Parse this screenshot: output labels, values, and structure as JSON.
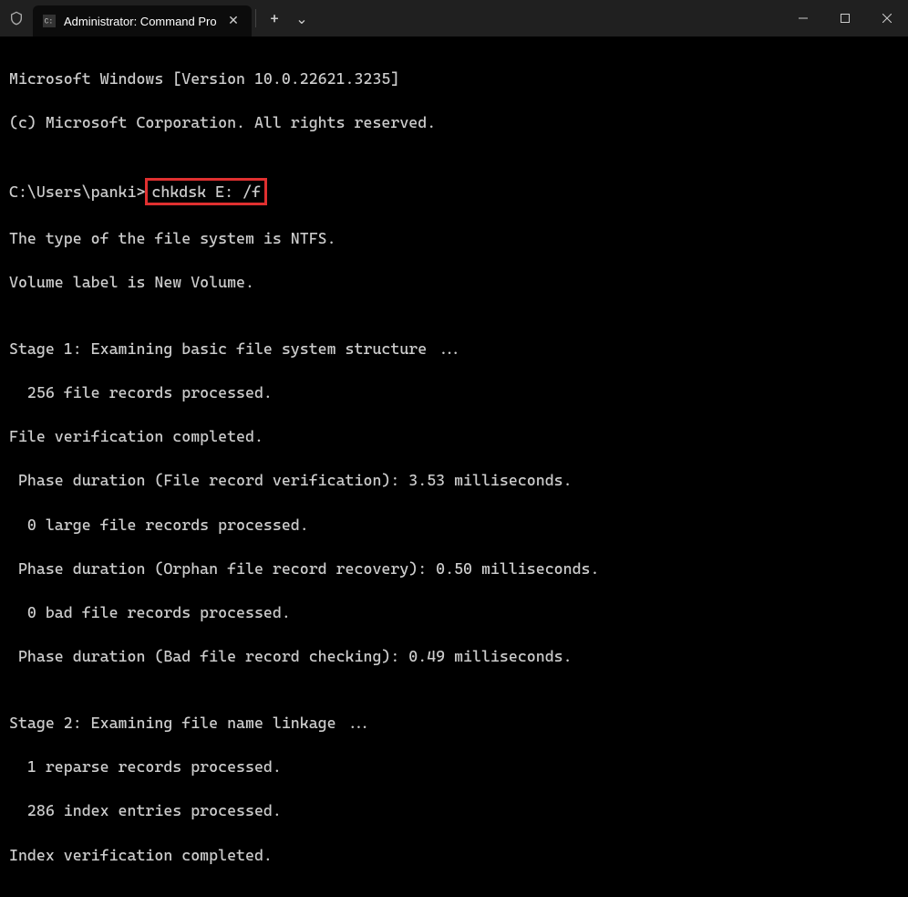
{
  "titlebar": {
    "tab_title": "Administrator: Command Pro",
    "new_tab_symbol": "+",
    "dropdown_symbol": "⌄",
    "close_symbol": "✕",
    "minimize_symbol": "—",
    "maximize_symbol": "▢"
  },
  "terminal": {
    "line1": "Microsoft Windows [Version 10.0.22621.3235]",
    "line2": "(c) Microsoft Corporation. All rights reserved.",
    "blank1": "",
    "prompt": "C:\\Users\\panki>",
    "command": "chkdsk E: /f",
    "line3": "The type of the file system is NTFS.",
    "line4": "Volume label is New Volume.",
    "blank2": "",
    "line5": "Stage 1: Examining basic file system structure ...",
    "line6": "  256 file records processed.",
    "line7": "File verification completed.",
    "line8": " Phase duration (File record verification): 3.53 milliseconds.",
    "line9": "  0 large file records processed.",
    "line10": " Phase duration (Orphan file record recovery): 0.50 milliseconds.",
    "line11": "  0 bad file records processed.",
    "line12": " Phase duration (Bad file record checking): 0.49 milliseconds.",
    "blank3": "",
    "line13": "Stage 2: Examining file name linkage ...",
    "line14": "  1 reparse records processed.",
    "line15": "  286 index entries processed.",
    "line16": "Index verification completed."
  }
}
